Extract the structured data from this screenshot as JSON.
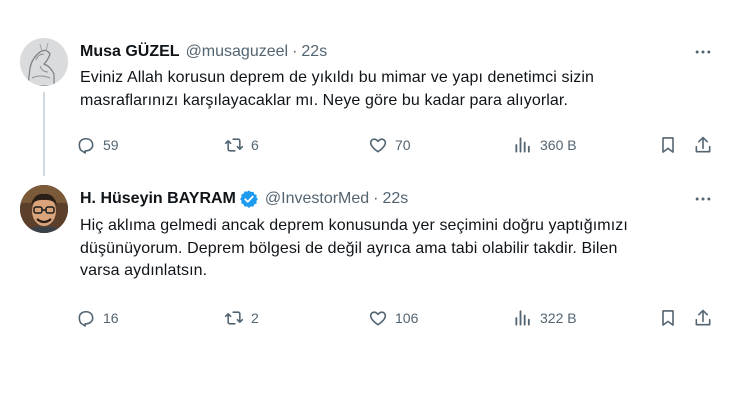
{
  "tweets": [
    {
      "display_name": "Musa GÜZEL",
      "handle": "@musaguzeel",
      "separator": "·",
      "time": "22s",
      "verified": false,
      "avatar_icon": "sketch-profile-icon",
      "text_lines": [
        "Eviniz Allah korusun deprem de yıkıldı bu mimar ve yapı denetimci sizin",
        "masraflarınızı karşılayacaklar mı. Neye göre bu kadar para alıyorlar."
      ],
      "replies": "59",
      "retweets": "6",
      "likes": "70",
      "views": "360 B"
    },
    {
      "display_name": "H. Hüseyin BAYRAM",
      "handle": "@InvestorMed",
      "separator": "·",
      "time": "22s",
      "verified": true,
      "avatar_icon": "man-with-glasses-icon",
      "text_lines": [
        "Hiç aklıma gelmedi ancak deprem konusunda yer seçimini doğru yaptığımızı",
        "düşünüyorum. Deprem bölgesi de değil ayrıca ama tabi olabilir takdir. Bilen",
        "varsa aydınlatsın."
      ],
      "replies": "16",
      "retweets": "2",
      "likes": "106",
      "views": "322 B"
    }
  ],
  "colors": {
    "text": "#0f1419",
    "secondary": "#536471",
    "verified": "#1d9bf0",
    "thread_line": "#cfd9de"
  }
}
